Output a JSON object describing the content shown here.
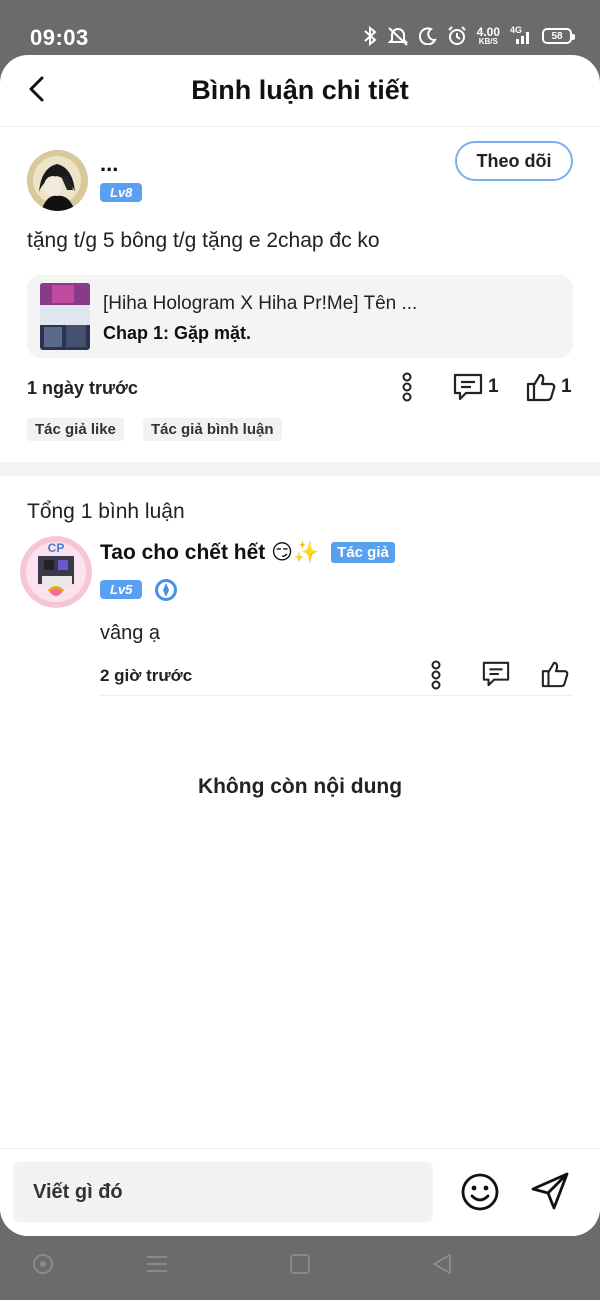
{
  "status_bar": {
    "time": "09:03",
    "speed_value": "4.00",
    "speed_unit": "KB/S",
    "network": "4G",
    "battery": "58"
  },
  "header": {
    "title": "Bình luận chi tiết",
    "back_icon": "chevron-left-icon"
  },
  "post": {
    "author_name": "...",
    "level": "Lv8",
    "follow_label": "Theo dõi",
    "text": "tặng t/g 5 bông t/g tặng e 2chap đc ko",
    "chapter": {
      "title": "[Hiha Hologram X Hiha Pr!Me] Tên ...",
      "subtitle": "Chap 1: Gặp mặt."
    },
    "time": "1 ngày trước",
    "reply_count": "1",
    "like_count": "1",
    "tags": [
      "Tác giả like",
      "Tác giả bình luận"
    ]
  },
  "comments": {
    "total_label": "Tổng 1 bình luận",
    "items": [
      {
        "name": "Tao cho chết hết 😏✨",
        "author_tag": "Tác giả",
        "level": "Lv5",
        "text": "vâng ạ",
        "time": "2 giờ trước"
      }
    ]
  },
  "end_label": "Không còn nội dung",
  "input": {
    "placeholder": "Viết gì đó"
  },
  "colors": {
    "accent_blue": "#5aa0f0",
    "follow_border": "#7ab0ee",
    "system_bar": "#6b6b6b"
  }
}
